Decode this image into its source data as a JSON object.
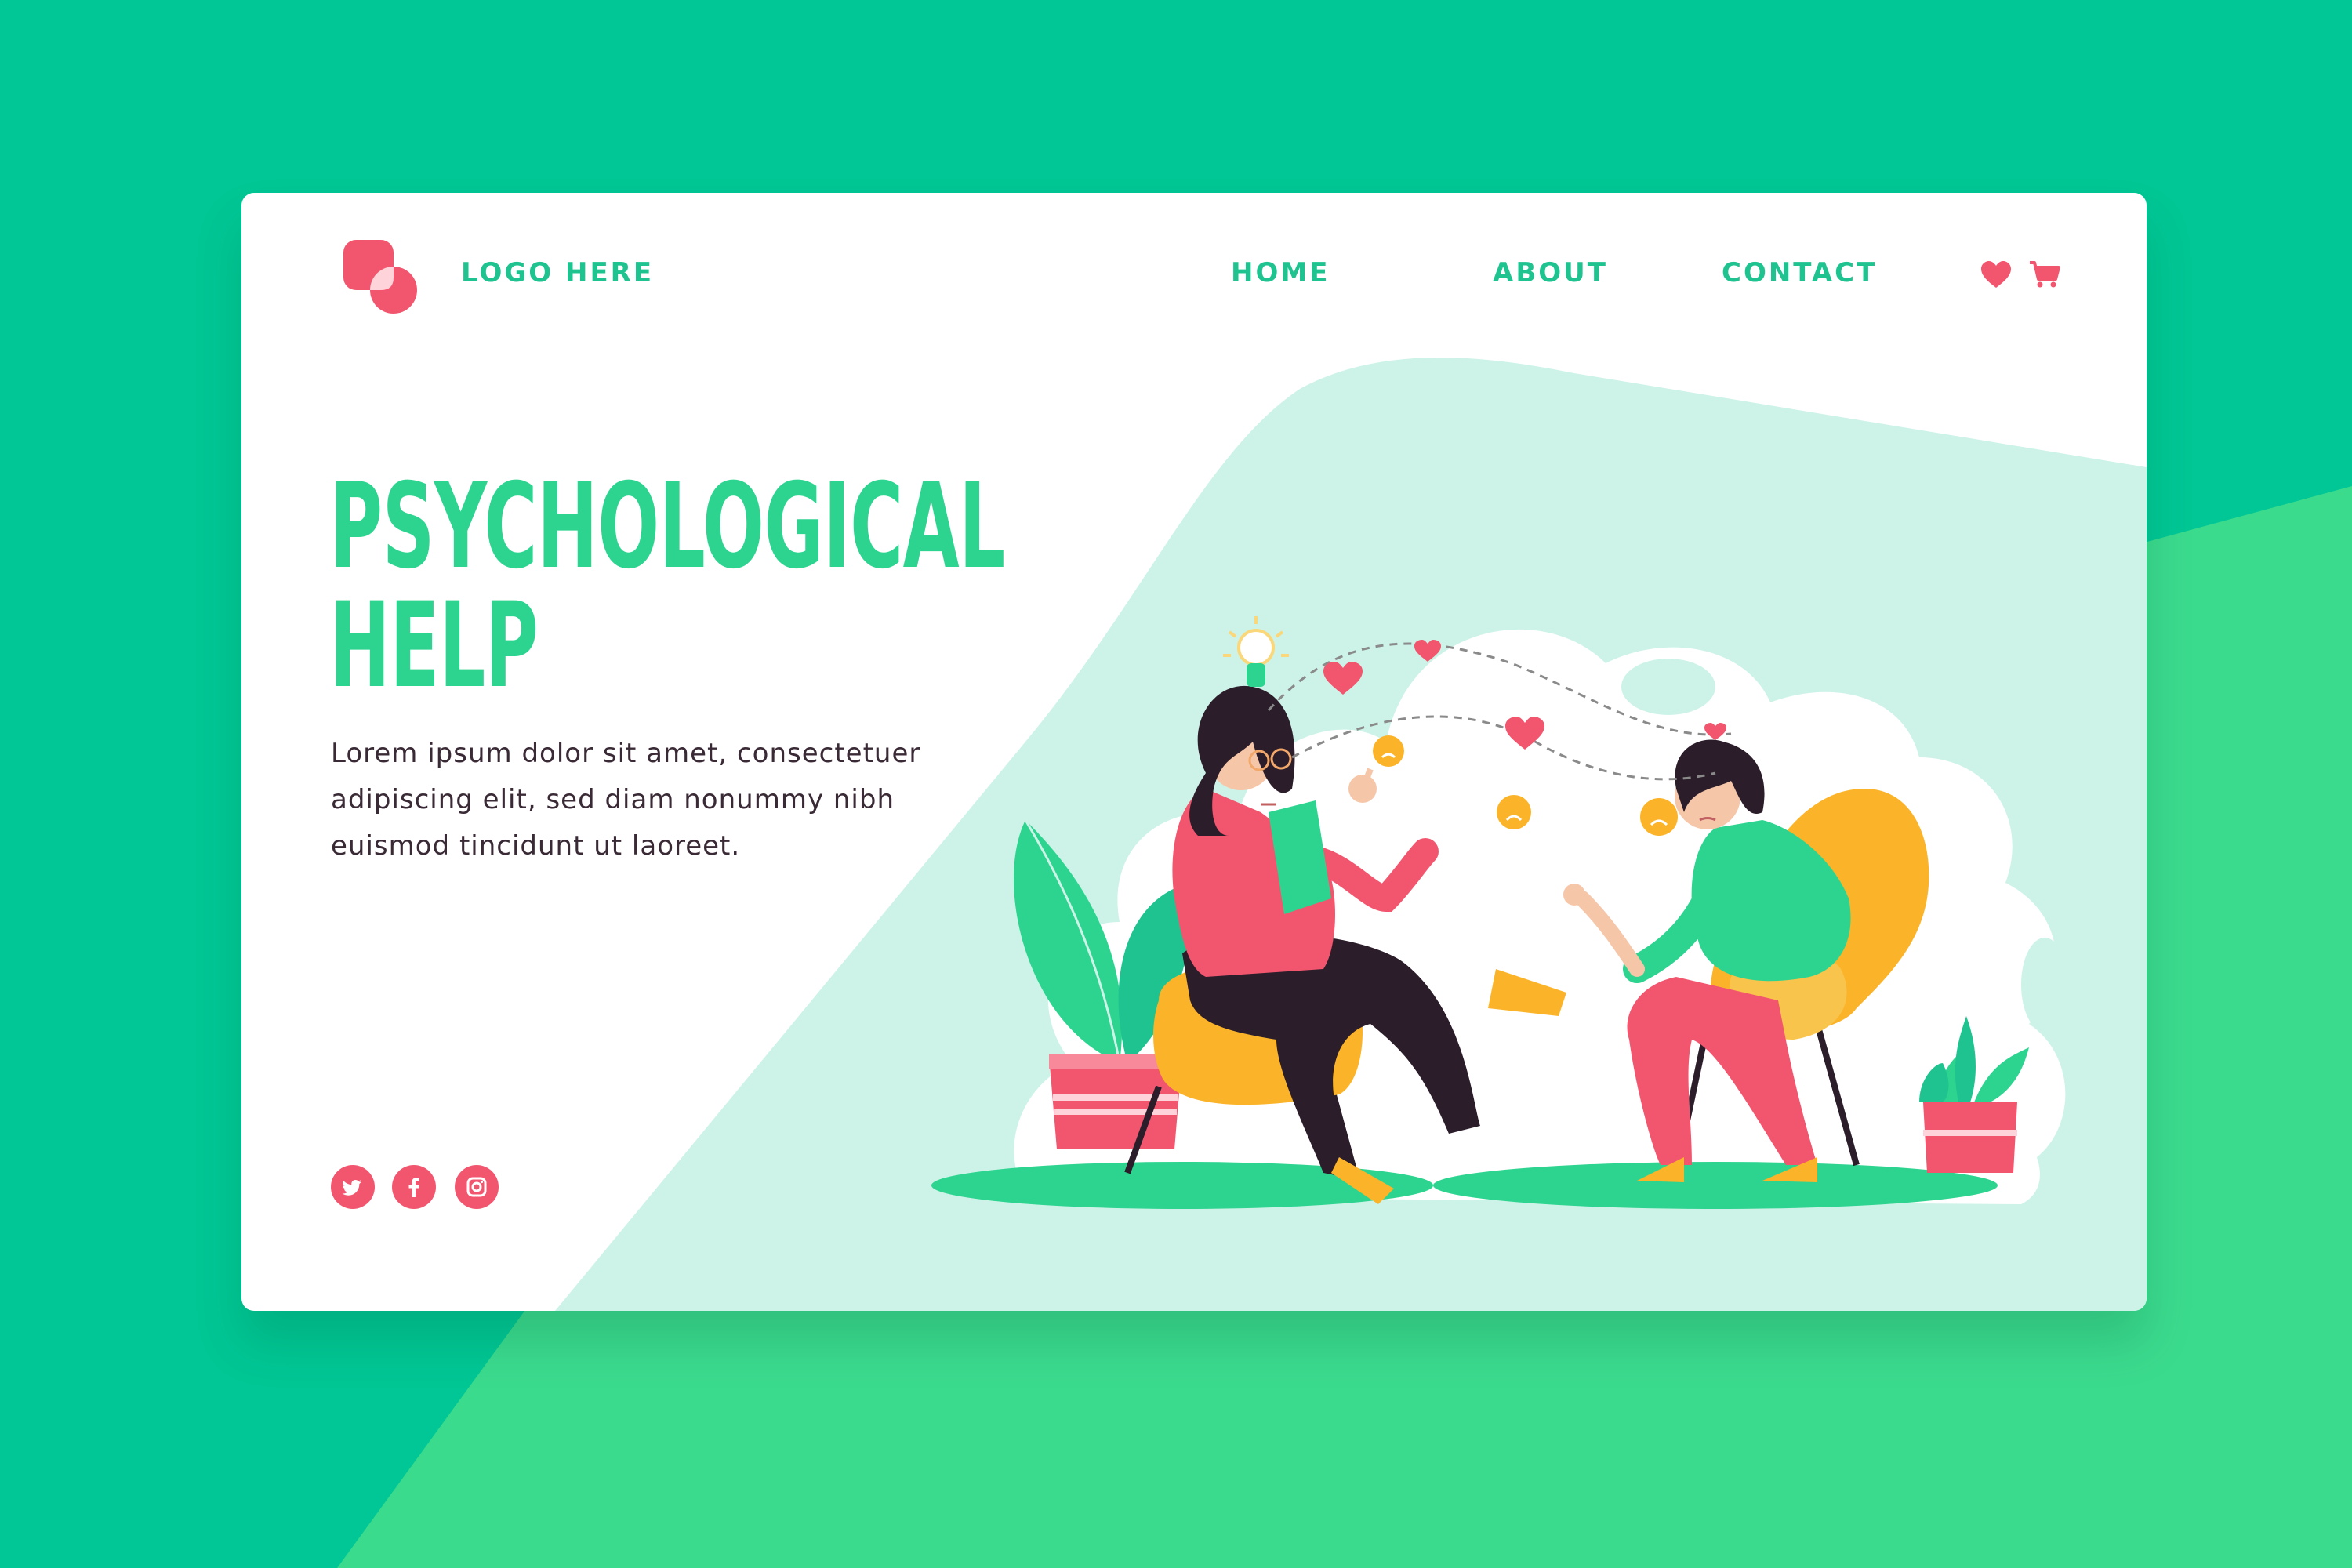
{
  "colors": {
    "background_top": "#00c795",
    "background_bottom": "#3bdb8e",
    "accent_green": "#2dd48f",
    "accent_pink": "#f2566f",
    "card": "#ffffff",
    "mint_shape": "#cdf3e8"
  },
  "header": {
    "logo_text": "LOGO HERE",
    "nav": [
      "HOME",
      "ABOUT",
      "CONTACT"
    ],
    "icons": [
      "heart-icon",
      "cart-icon"
    ]
  },
  "hero": {
    "title_lines": [
      "PSYCHOLOGICAL",
      "HELP"
    ],
    "body": "Lorem ipsum dolor sit amet, consectetuer adipiscing elit, sed diam nonummy nibh euismod tincidunt ut laoreet."
  },
  "social": [
    "twitter-icon",
    "facebook-icon",
    "instagram-icon"
  ]
}
